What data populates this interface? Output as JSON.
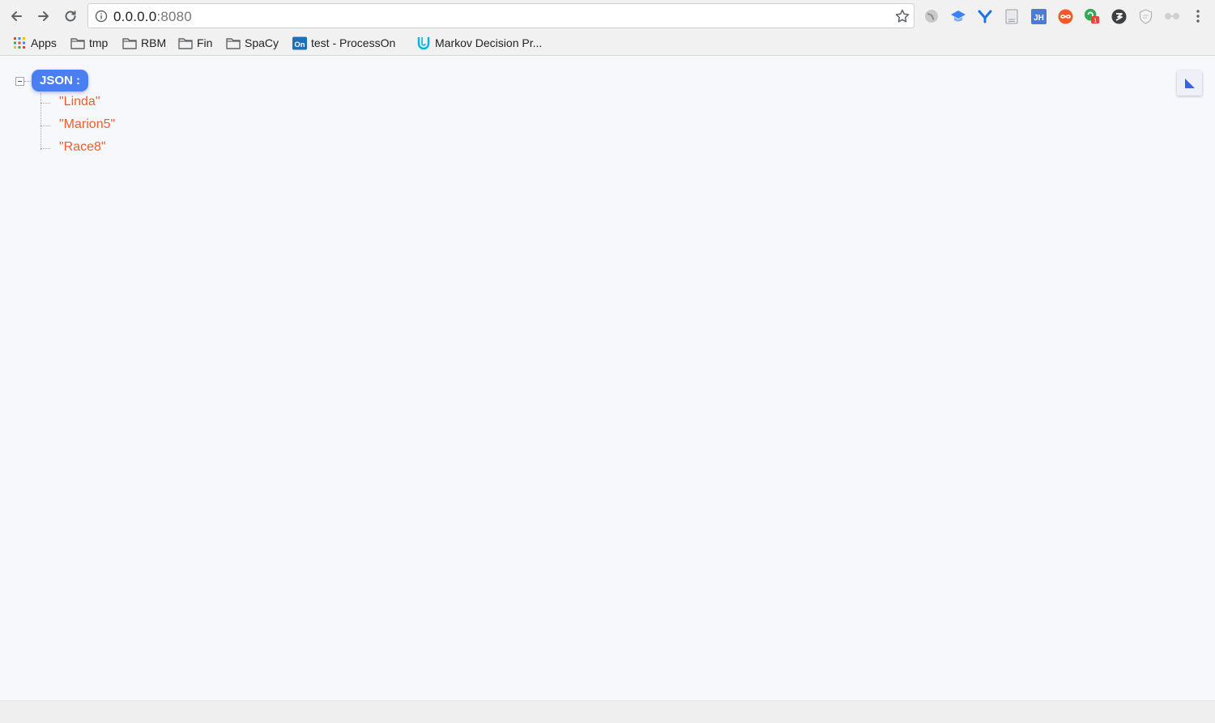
{
  "browser": {
    "url_host": "0.0.0.0",
    "url_port": ":8080",
    "extensions": [
      {
        "icon": "globe-extension-icon",
        "color": "#8a8a8a"
      },
      {
        "icon": "blue-cap-extension-icon",
        "color": "#3b82f6"
      },
      {
        "icon": "y-extension-icon",
        "color": "#1a73e8"
      },
      {
        "icon": "page-extension-icon",
        "color": "#9aa0a6"
      },
      {
        "icon": "jh-extension-icon",
        "text": "JH",
        "color": "#4a7cd6"
      },
      {
        "icon": "infinity-extension-icon",
        "color": "#f05a28"
      },
      {
        "icon": "green-badge-extension-icon",
        "badge": "1",
        "color": "#34a853"
      },
      {
        "icon": "dark-circle-extension-icon",
        "color": "#3c4043"
      },
      {
        "icon": "shield-extension-icon",
        "color": "#b0b0b0"
      },
      {
        "icon": "glasses-extension-icon",
        "color": "#b0b0b0"
      }
    ]
  },
  "bookmarks": [
    {
      "label": "Apps",
      "icon": "apps-grid-icon"
    },
    {
      "label": "tmp",
      "icon": "folder-icon"
    },
    {
      "label": "RBM",
      "icon": "folder-icon"
    },
    {
      "label": "Fin",
      "icon": "folder-icon"
    },
    {
      "label": "SpaCy",
      "icon": "folder-icon"
    },
    {
      "label": "test - ProcessOn",
      "icon": "processon-icon",
      "icon_text": "On"
    },
    {
      "label": "Markov Decision Pr...",
      "icon": "udacity-icon"
    }
  ],
  "tree": {
    "root_label": "JSON :",
    "items": [
      "\"Linda\"",
      "\"Marion5\"",
      "\"Race8\""
    ]
  },
  "colors": {
    "accent": "#4c7ef3",
    "value_text": "#f25c2d"
  }
}
